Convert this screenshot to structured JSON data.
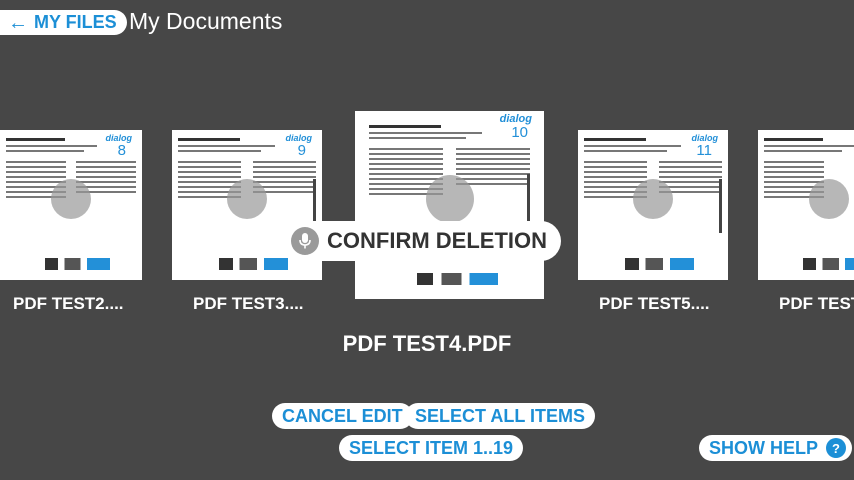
{
  "header": {
    "back_label": "MY FILES",
    "title": "My Documents"
  },
  "files": [
    {
      "page_number": "8",
      "label": "PDF TEST2...."
    },
    {
      "page_number": "9",
      "label": "PDF TEST3...."
    },
    {
      "page_number": "10",
      "label": "PDF TEST4.PDF"
    },
    {
      "page_number": "11",
      "label": "PDF TEST5...."
    },
    {
      "page_number": "",
      "label": "PDF TEST"
    }
  ],
  "overlay": {
    "confirm_label": "CONFIRM DELETION",
    "mic_icon": "microphone-icon"
  },
  "selected_name": "PDF TEST4.PDF",
  "actions": {
    "cancel_edit": "CANCEL EDIT",
    "select_all": "SELECT ALL ITEMS",
    "select_item": "SELECT ITEM 1..19",
    "show_help": "SHOW HELP",
    "help_icon": "?"
  },
  "colors": {
    "background": "#474747",
    "accent": "#1c8fd6"
  }
}
